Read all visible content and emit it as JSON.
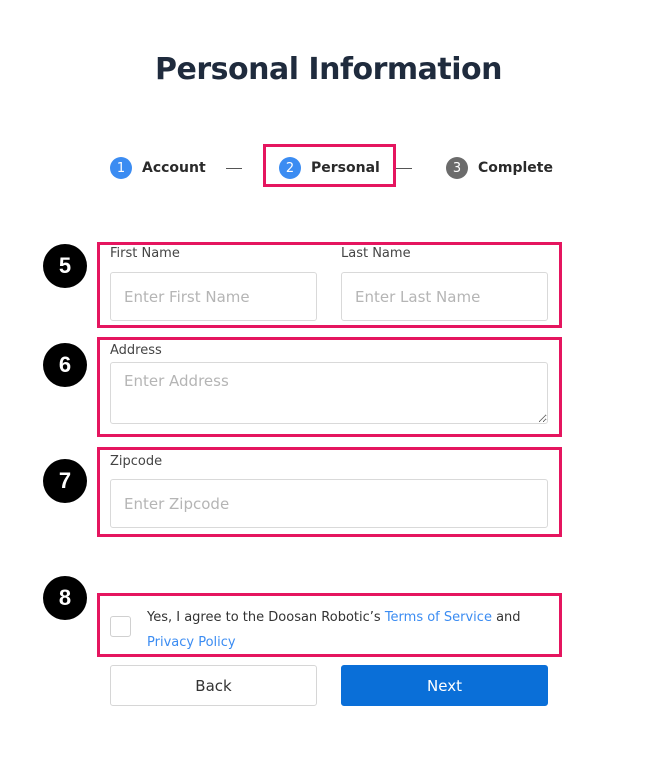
{
  "page": {
    "title": "Personal Information"
  },
  "stepper": {
    "steps": [
      {
        "number": "1",
        "label": "Account",
        "state": "completed"
      },
      {
        "number": "2",
        "label": "Personal",
        "state": "active"
      },
      {
        "number": "3",
        "label": "Complete",
        "state": "inactive"
      }
    ]
  },
  "annotations": {
    "markers": [
      "5",
      "6",
      "7",
      "8"
    ],
    "highlight_color": "#e5155f"
  },
  "form": {
    "first_name": {
      "label": "First Name",
      "value": "",
      "placeholder": "Enter First Name"
    },
    "last_name": {
      "label": "Last Name",
      "value": "",
      "placeholder": "Enter Last Name"
    },
    "address": {
      "label": "Address",
      "value": "",
      "placeholder": "Enter Address"
    },
    "zipcode": {
      "label": "Zipcode",
      "value": "",
      "placeholder": "Enter Zipcode"
    },
    "agreement": {
      "checked": false,
      "text_before": "Yes, I agree to the Doosan Robotic’s ",
      "terms_link": "Terms of Service",
      "text_middle": " and",
      "privacy_link": "Privacy Policy"
    }
  },
  "buttons": {
    "back": "Back",
    "next": "Next"
  },
  "colors": {
    "primary": "#0a6fd8",
    "step_active": "#3b8cf2",
    "step_inactive": "#6b6b6b",
    "link": "#3b8cf2"
  }
}
